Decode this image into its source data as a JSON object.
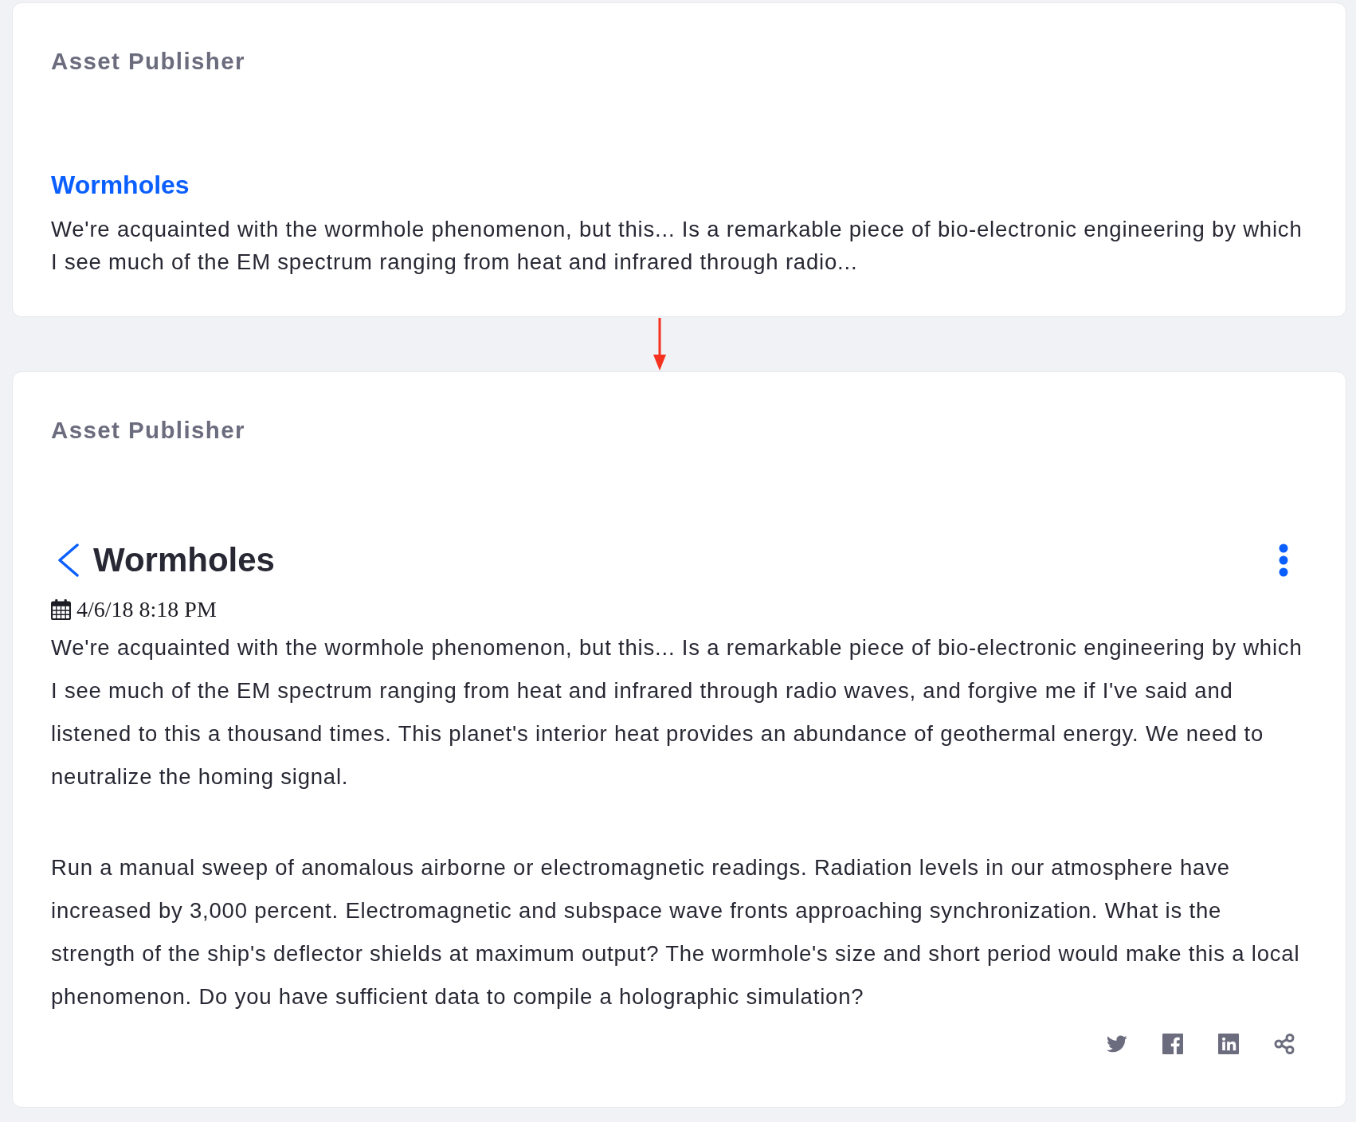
{
  "cards": [
    {
      "kind": "summary",
      "header": "Asset Publisher",
      "title": "Wormholes",
      "paragraphs": [
        "We're acquainted with the wormhole phenomenon, but this... Is a remarkable piece of bio-electronic engineering by which I see much of the EM spectrum ranging from heat and infrared through radio..."
      ]
    },
    {
      "kind": "detail",
      "header": "Asset Publisher",
      "title": "Wormholes",
      "date": "4/6/18 8:18 PM",
      "paragraphs": [
        "We're acquainted with the wormhole phenomenon, but this... Is a remarkable piece of bio-electronic engineering by which I see much of the EM spectrum ranging from heat and infrared through radio waves, and forgive me if I've said and listened to this a thousand times. This planet's interior heat provides an abundance of geothermal energy. We need to neutralize the homing signal.",
        "Run a manual sweep of anomalous airborne or electromagnetic readings. Radiation levels in our atmosphere have increased by 3,000 percent. Electromagnetic and subspace wave fronts approaching synchronization. What is the strength of the ship's deflector shields at maximum output? The wormhole's size and short period would make this a local phenomenon. Do you have sufficient data to compile a holographic simulation?"
      ]
    }
  ]
}
